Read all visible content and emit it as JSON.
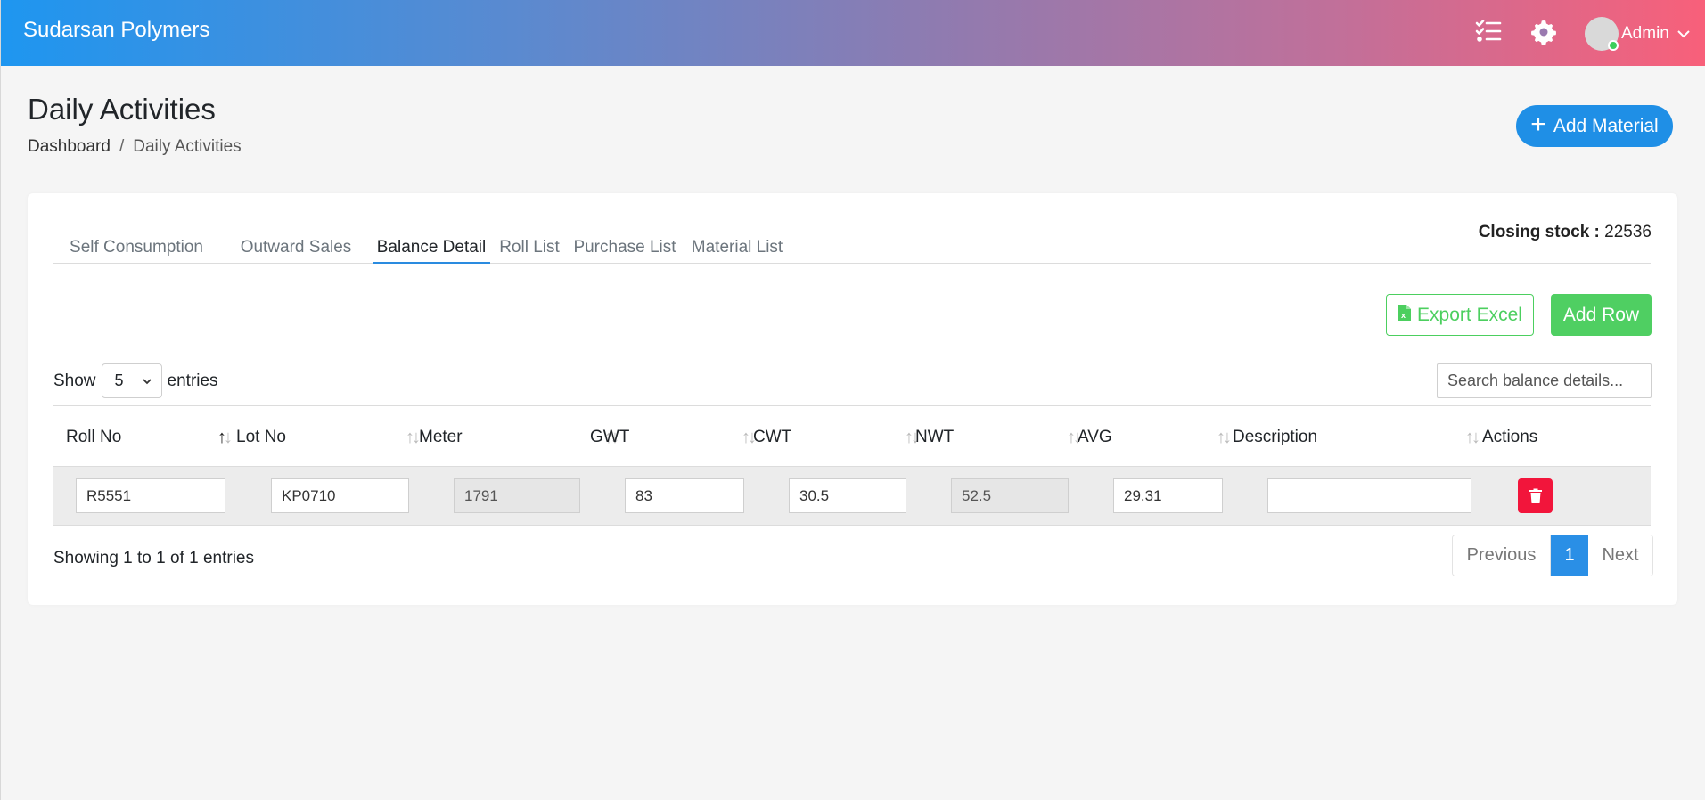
{
  "app": {
    "brand": "Sudarsan Polymers",
    "user_name": "Admin",
    "icons": {
      "tasks": "tasks-list-icon",
      "settings": "gear-icon",
      "avatar": "user-avatar",
      "chevron": "chevron-down-icon"
    },
    "colors": {
      "gradient_start": "#1e96f0",
      "gradient_end": "#f8607a",
      "primary": "#2a8fe6",
      "success": "#4fcf62",
      "danger": "#f2153b"
    }
  },
  "page": {
    "title": "Daily Activities",
    "breadcrumb": [
      "Dashboard",
      "/",
      "Daily Activities"
    ],
    "add_material_label": "Add Material"
  },
  "tabs": [
    {
      "label": "Self Consumption",
      "active": false
    },
    {
      "label": "Outward Sales",
      "active": false
    },
    {
      "label": "Balance Detail",
      "active": true
    },
    {
      "label": "Roll List",
      "active": false
    },
    {
      "label": "Purchase List",
      "active": false
    },
    {
      "label": "Material List",
      "active": false
    }
  ],
  "closing_stock": {
    "label": "Closing stock :",
    "value": "22536"
  },
  "actions": {
    "export_label": "Export Excel",
    "add_row_label": "Add Row"
  },
  "table_controls": {
    "show_label": "Show",
    "entries_value": "5",
    "entries_label": "entries",
    "search_placeholder": "Search balance details..."
  },
  "table": {
    "columns": [
      "Roll No",
      "Lot No",
      "Meter",
      "GWT",
      "CWT",
      "NWT",
      "AVG",
      "Description",
      "Actions"
    ],
    "rows": [
      {
        "roll_no": "R5551",
        "lot_no": "KP0710",
        "meter": "1791",
        "gwt": "83",
        "cwt": "30.5",
        "nwt": "52.5",
        "avg": "29.31",
        "description": ""
      }
    ]
  },
  "footer": {
    "info": "Showing 1 to 1 of 1 entries",
    "prev_label": "Previous",
    "current_page": "1",
    "next_label": "Next"
  }
}
